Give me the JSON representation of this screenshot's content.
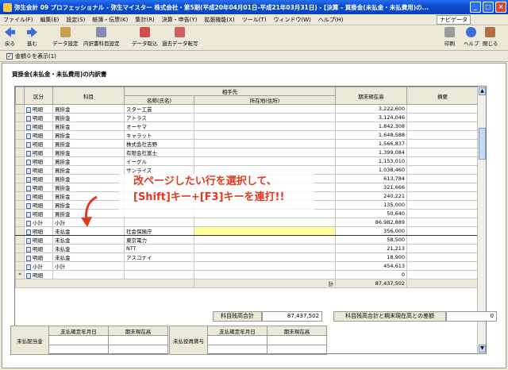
{
  "window": {
    "title": "弥生会計 09 プロフェッショナル - 弥生マイスター 株式会社・第5期(平成20年04月01日-平成21年03月31日) - [決算 - 買掛金(未払金・未払費用)の..."
  },
  "menu": [
    "ファイル(F)",
    "編集(E)",
    "設定(S)",
    "帳簿・伝票(K)",
    "集計(R)",
    "決算・申告(Y)",
    "拡張機能(X)",
    "ツール(T)",
    "ウィンドウ(W)",
    "ヘルプ(H)"
  ],
  "navi": "ナビゲータ",
  "toolbar": {
    "back": "戻る",
    "forward": "進む",
    "data_settings": "データ設定",
    "breakdown_item_settings": "内訳書科目設定",
    "data_import": "データ取込",
    "prev_data_copy": "過去データ転写",
    "print": "印刷",
    "help": "ヘルプ",
    "close": "閉じる"
  },
  "option": {
    "show_zero_label": "金額０を表示(1)"
  },
  "sheet_title": "買掛金(未払金・未払費用)の内訳書",
  "table": {
    "headers": {
      "kubun": "区分",
      "kamoku": "科目",
      "aite": "相手先",
      "name": "名称(氏名)",
      "address": "所在地(住所)",
      "amount": "期末現在高",
      "tekiyo": "摘要"
    },
    "rows": [
      {
        "k": "明細",
        "s": "買掛金",
        "n": "スター工芸",
        "v": "3,222,600"
      },
      {
        "k": "明細",
        "s": "買掛金",
        "n": "アトラス",
        "v": "3,124,046"
      },
      {
        "k": "明細",
        "s": "買掛金",
        "n": "オーヤマ",
        "v": "1,842,308"
      },
      {
        "k": "明細",
        "s": "買掛金",
        "n": "キャラット",
        "v": "1,648,588"
      },
      {
        "k": "明細",
        "s": "買掛金",
        "n": "株式会社吉野",
        "v": "1,566,837"
      },
      {
        "k": "明細",
        "s": "買掛金",
        "n": "有限会社富士",
        "v": "1,399,084"
      },
      {
        "k": "明細",
        "s": "買掛金",
        "n": "イーグル",
        "v": "1,153,010"
      },
      {
        "k": "明細",
        "s": "買掛金",
        "n": "サンライズ",
        "v": "1,038,460"
      },
      {
        "k": "明細",
        "s": "買掛金",
        "n": "",
        "v": "613,784"
      },
      {
        "k": "明細",
        "s": "買掛金",
        "n": "",
        "v": "321,666"
      },
      {
        "k": "明細",
        "s": "買掛金",
        "n": "",
        "v": "240,221"
      },
      {
        "k": "明細",
        "s": "買掛金",
        "n": "",
        "v": "135,000"
      },
      {
        "k": "明細",
        "s": "買掛金",
        "n": "",
        "v": "50,640"
      },
      {
        "k": "小計",
        "s": "小計",
        "n": "",
        "v": "86,982,889"
      },
      {
        "k": "明細",
        "s": "未払金",
        "n": "社会保険庁",
        "v": "356,000",
        "sel": true
      },
      {
        "k": "明細",
        "s": "未払金",
        "n": "東京電力",
        "v": "58,500"
      },
      {
        "k": "明細",
        "s": "未払金",
        "n": "NTT",
        "v": "21,213"
      },
      {
        "k": "明細",
        "s": "未払金",
        "n": "アスコナイ",
        "v": "18,900"
      },
      {
        "k": "小計",
        "s": "小計",
        "n": "",
        "v": "454,613"
      },
      {
        "k": "明細",
        "s": "",
        "n": "",
        "v": "0",
        "star": true
      }
    ],
    "total_label": "計",
    "total_value": "87,437,502"
  },
  "summary": {
    "subject_total_label": "科目残高合計",
    "subject_total_value": "87,437,502",
    "diff_label": "科目残高合計と期末現在高との差額",
    "diff_value": "0"
  },
  "bottom": {
    "left_label": "未払配当金",
    "left_h1": "支払確定年月日",
    "left_h2": "期末現在高",
    "right_label": "未払役員賞与",
    "right_h1": "支払確定年月日",
    "right_h2": "期末現在高"
  },
  "annotation": {
    "line1": "改ページしたい行を選択して、",
    "line2": "[Shift]キー+[F3]キーを連打!!"
  }
}
